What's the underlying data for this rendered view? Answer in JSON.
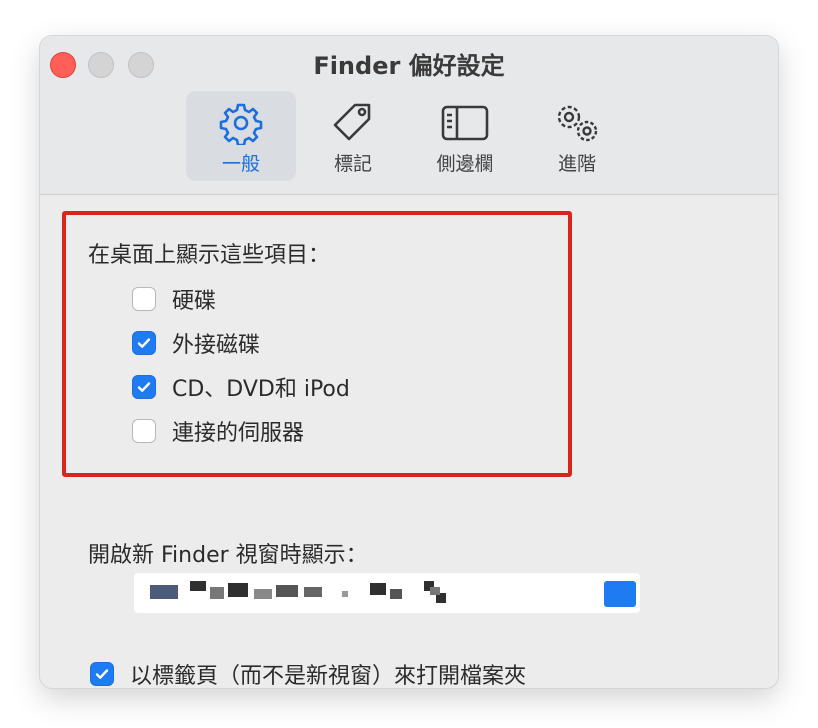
{
  "window": {
    "title": "Finder 偏好設定"
  },
  "tabs": [
    {
      "label": "一般",
      "icon": "gear-icon",
      "active": true
    },
    {
      "label": "標記",
      "icon": "tag-icon",
      "active": false
    },
    {
      "label": "側邊欄",
      "icon": "sidebar-icon",
      "active": false
    },
    {
      "label": "進階",
      "icon": "gears-icon",
      "active": false
    }
  ],
  "desktop_section": {
    "label": "在桌面上顯示這些項目：",
    "items": [
      {
        "label": "硬碟",
        "checked": false
      },
      {
        "label": "外接磁碟",
        "checked": true
      },
      {
        "label": "CD、DVD和 iPod",
        "checked": true
      },
      {
        "label": "連接的伺服器",
        "checked": false
      }
    ]
  },
  "new_window": {
    "label": "開啟新 Finder 視窗時顯示："
  },
  "tabs_option": {
    "label": "以標籤頁（而不是新視窗）來打開檔案夾",
    "checked": true
  },
  "colors": {
    "accent": "#1f7bf2",
    "highlight": "#d8261f",
    "close": "#ff5f57"
  }
}
